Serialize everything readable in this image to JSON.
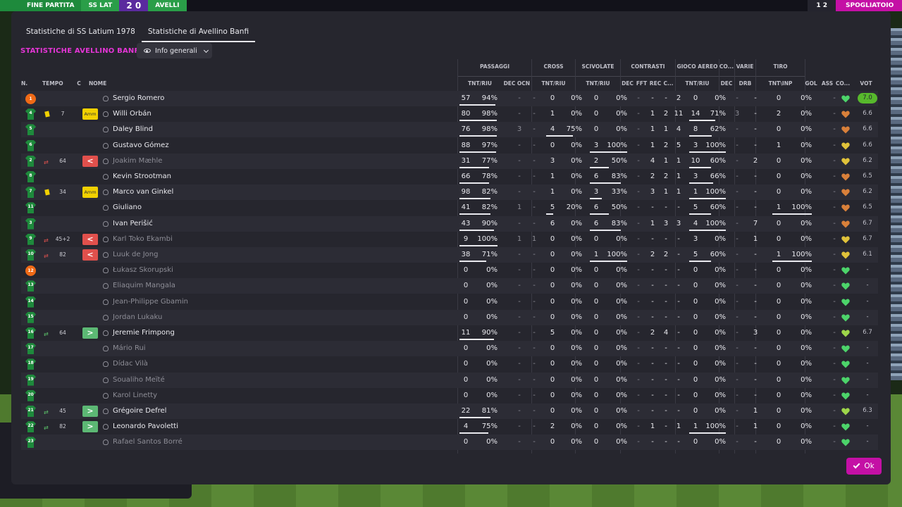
{
  "background": {
    "left_label": "FINE PARTITA",
    "home_abbr": "SS LAT",
    "score": "2 0",
    "away_abbr": "AVELLI",
    "right_score": "1 2",
    "right_button": "SPOGLIATOIO"
  },
  "tabs": [
    {
      "label": "Statistiche di SS Latium 1978",
      "active": false
    },
    {
      "label": "Statistiche di Avellino Banfi",
      "active": true
    }
  ],
  "team_title": "STATISTICHE AVELLINO BANFI",
  "view_dropdown": {
    "selected": "Info generali"
  },
  "groups": {
    "passaggi": "PASSAGGI",
    "cross": "CROSS",
    "scivolate": "SCIVOLATE",
    "contrasti": "CONTRASTI",
    "gioco_aereo": "GIOCO AEREO",
    "co": "CO...",
    "varie": "VARIE",
    "tiro": "TIRO"
  },
  "headers": {
    "n": "N.",
    "tempo": "TEMPO",
    "c": "C",
    "nome": "NOME",
    "pass_tnt": "TNT/RIU",
    "pass_dec": "DEC",
    "pass_ocn": "OCN",
    "cross_tnt": "TNT/RIU",
    "sciv_tnt": "TNT/RIU",
    "con_dec": "DEC",
    "con_fft": "FFT",
    "con_rec": "REC",
    "con_c": "C...",
    "aer_tnt": "TNT/RIU",
    "co_dec": "DEC",
    "var_drb": "DRB",
    "tiro_tnt": "TNT\\INP",
    "gol": "GOL",
    "ass": "ASS",
    "con_col": "CO...",
    "vot": "VOT"
  },
  "heart_colors": {
    "green": "#4cd46a",
    "lime": "#9ed64a",
    "yellow": "#e0c23a",
    "orange": "#d9803a"
  },
  "players": [
    {
      "num": "1",
      "gk": true,
      "tempo": "",
      "ycard": false,
      "sub": "",
      "tag": "",
      "name": "Sergio Romero",
      "active": true,
      "pass_t": "57",
      "pass_p": "94%",
      "pass_fill": 0.94,
      "dec": "-",
      "ocn": "-",
      "cross_t": "0",
      "cross_p": "0%",
      "cross_fill": 0,
      "sciv_t": "0",
      "sciv_p": "0%",
      "sciv_fill": 0,
      "c_dec": "-",
      "c_fft": "-",
      "c_rec": "-",
      "c_c": "2",
      "aer_t": "0",
      "aer_p": "0%",
      "aer_fill": 0,
      "co_dec": "-",
      "drb": "-",
      "tiro_t": "0",
      "tiro_p": "0%",
      "tiro_fill": 0,
      "gol": "",
      "ass": "-",
      "heart": "green",
      "vote": "7.0",
      "vote_hi": true
    },
    {
      "num": "4",
      "gk": false,
      "tempo": "7",
      "ycard": true,
      "sub": "",
      "tag": "amm",
      "tag_label": "Amm",
      "name": "Willi Orbán",
      "active": true,
      "pass_t": "80",
      "pass_p": "98%",
      "pass_fill": 0.98,
      "dec": "-",
      "ocn": "-",
      "cross_t": "1",
      "cross_p": "0%",
      "cross_fill": 0,
      "sciv_t": "0",
      "sciv_p": "0%",
      "sciv_fill": 0,
      "c_dec": "-",
      "c_fft": "1",
      "c_rec": "2",
      "c_c": "11",
      "aer_t": "14",
      "aer_p": "71%",
      "aer_fill": 0.71,
      "co_dec": "3",
      "drb": "-",
      "tiro_t": "2",
      "tiro_p": "0%",
      "tiro_fill": 0,
      "gol": "",
      "ass": "-",
      "heart": "orange",
      "vote": "6.6",
      "vote_hi": false
    },
    {
      "num": "5",
      "gk": false,
      "tempo": "",
      "ycard": false,
      "sub": "",
      "tag": "",
      "name": "Daley Blind",
      "active": true,
      "pass_t": "76",
      "pass_p": "98%",
      "pass_fill": 0.98,
      "dec": "3",
      "ocn": "-",
      "cross_t": "4",
      "cross_p": "75%",
      "cross_fill": 0.75,
      "sciv_t": "0",
      "sciv_p": "0%",
      "sciv_fill": 0,
      "c_dec": "-",
      "c_fft": "1",
      "c_rec": "1",
      "c_c": "4",
      "aer_t": "8",
      "aer_p": "62%",
      "aer_fill": 0.62,
      "co_dec": "-",
      "drb": "-",
      "tiro_t": "0",
      "tiro_p": "0%",
      "tiro_fill": 0,
      "gol": "",
      "ass": "-",
      "heart": "orange",
      "vote": "6.6",
      "vote_hi": false
    },
    {
      "num": "6",
      "gk": false,
      "tempo": "",
      "ycard": false,
      "sub": "",
      "tag": "",
      "name": "Gustavo Gómez",
      "active": true,
      "pass_t": "88",
      "pass_p": "97%",
      "pass_fill": 0.97,
      "dec": "-",
      "ocn": "-",
      "cross_t": "0",
      "cross_p": "0%",
      "cross_fill": 0,
      "sciv_t": "3",
      "sciv_p": "100%",
      "sciv_fill": 1,
      "c_dec": "-",
      "c_fft": "1",
      "c_rec": "2",
      "c_c": "5",
      "aer_t": "3",
      "aer_p": "100%",
      "aer_fill": 1,
      "co_dec": "-",
      "drb": "-",
      "tiro_t": "1",
      "tiro_p": "0%",
      "tiro_fill": 0,
      "gol": "",
      "ass": "-",
      "heart": "yellow",
      "vote": "6.6",
      "vote_hi": false
    },
    {
      "num": "2",
      "gk": false,
      "tempo": "64",
      "ycard": false,
      "sub": "out",
      "tag": "out",
      "tag_label": "<",
      "name": "Joakim Mæhle",
      "active": false,
      "pass_t": "31",
      "pass_p": "77%",
      "pass_fill": 0.77,
      "dec": "-",
      "ocn": "-",
      "cross_t": "3",
      "cross_p": "0%",
      "cross_fill": 0,
      "sciv_t": "2",
      "sciv_p": "50%",
      "sciv_fill": 0.5,
      "c_dec": "-",
      "c_fft": "4",
      "c_rec": "1",
      "c_c": "1",
      "aer_t": "10",
      "aer_p": "60%",
      "aer_fill": 0.6,
      "co_dec": "-",
      "drb": "2",
      "tiro_t": "0",
      "tiro_p": "0%",
      "tiro_fill": 0,
      "gol": "",
      "ass": "-",
      "heart": "yellow",
      "vote": "6.2",
      "vote_hi": false
    },
    {
      "num": "8",
      "gk": false,
      "tempo": "",
      "ycard": false,
      "sub": "",
      "tag": "",
      "name": "Kevin Strootman",
      "active": true,
      "pass_t": "66",
      "pass_p": "78%",
      "pass_fill": 0.78,
      "dec": "-",
      "ocn": "-",
      "cross_t": "1",
      "cross_p": "0%",
      "cross_fill": 0,
      "sciv_t": "6",
      "sciv_p": "83%",
      "sciv_fill": 0.83,
      "c_dec": "-",
      "c_fft": "2",
      "c_rec": "2",
      "c_c": "1",
      "aer_t": "3",
      "aer_p": "66%",
      "aer_fill": 0.66,
      "co_dec": "-",
      "drb": "-",
      "tiro_t": "0",
      "tiro_p": "0%",
      "tiro_fill": 0,
      "gol": "",
      "ass": "-",
      "heart": "orange",
      "vote": "6.5",
      "vote_hi": false
    },
    {
      "num": "7",
      "gk": false,
      "tempo": "34",
      "ycard": true,
      "sub": "",
      "tag": "amm",
      "tag_label": "Amm",
      "name": "Marco van Ginkel",
      "active": true,
      "pass_t": "98",
      "pass_p": "82%",
      "pass_fill": 0.82,
      "dec": "-",
      "ocn": "-",
      "cross_t": "1",
      "cross_p": "0%",
      "cross_fill": 0,
      "sciv_t": "3",
      "sciv_p": "33%",
      "sciv_fill": 0.33,
      "c_dec": "-",
      "c_fft": "3",
      "c_rec": "1",
      "c_c": "1",
      "aer_t": "1",
      "aer_p": "100%",
      "aer_fill": 1,
      "co_dec": "-",
      "drb": "-",
      "tiro_t": "0",
      "tiro_p": "0%",
      "tiro_fill": 0,
      "gol": "",
      "ass": "-",
      "heart": "orange",
      "vote": "6.2",
      "vote_hi": false
    },
    {
      "num": "11",
      "gk": false,
      "tempo": "",
      "ycard": false,
      "sub": "",
      "tag": "",
      "name": "Giuliano",
      "active": true,
      "pass_t": "41",
      "pass_p": "82%",
      "pass_fill": 0.82,
      "dec": "1",
      "ocn": "-",
      "cross_t": "5",
      "cross_p": "20%",
      "cross_fill": 0.2,
      "sciv_t": "6",
      "sciv_p": "50%",
      "sciv_fill": 0.5,
      "c_dec": "-",
      "c_fft": "-",
      "c_rec": "-",
      "c_c": "-",
      "aer_t": "5",
      "aer_p": "60%",
      "aer_fill": 0.6,
      "co_dec": "-",
      "drb": "-",
      "tiro_t": "1",
      "tiro_p": "100%",
      "tiro_fill": 1,
      "gol": "",
      "ass": "-",
      "heart": "orange",
      "vote": "6.5",
      "vote_hi": false
    },
    {
      "num": "3",
      "gk": false,
      "tempo": "",
      "ycard": false,
      "sub": "",
      "tag": "",
      "name": "Ivan Perišić",
      "active": true,
      "pass_t": "43",
      "pass_p": "90%",
      "pass_fill": 0.9,
      "dec": "-",
      "ocn": "-",
      "cross_t": "6",
      "cross_p": "0%",
      "cross_fill": 0,
      "sciv_t": "6",
      "sciv_p": "83%",
      "sciv_fill": 0.83,
      "c_dec": "-",
      "c_fft": "1",
      "c_rec": "3",
      "c_c": "3",
      "aer_t": "4",
      "aer_p": "100%",
      "aer_fill": 1,
      "co_dec": "-",
      "drb": "7",
      "tiro_t": "0",
      "tiro_p": "0%",
      "tiro_fill": 0,
      "gol": "",
      "ass": "-",
      "heart": "orange",
      "vote": "6.7",
      "vote_hi": false
    },
    {
      "num": "9",
      "gk": false,
      "tempo": "45+2",
      "ycard": false,
      "sub": "out",
      "tag": "out",
      "tag_label": "<",
      "name": "Karl Toko Ekambi",
      "active": false,
      "pass_t": "9",
      "pass_p": "100%",
      "pass_fill": 1,
      "dec": "1",
      "ocn": "1",
      "cross_t": "0",
      "cross_p": "0%",
      "cross_fill": 0,
      "sciv_t": "0",
      "sciv_p": "0%",
      "sciv_fill": 0,
      "c_dec": "-",
      "c_fft": "-",
      "c_rec": "-",
      "c_c": "-",
      "aer_t": "3",
      "aer_p": "0%",
      "aer_fill": 0,
      "co_dec": "-",
      "drb": "1",
      "tiro_t": "0",
      "tiro_p": "0%",
      "tiro_fill": 0,
      "gol": "",
      "ass": "-",
      "heart": "yellow",
      "vote": "6.7",
      "vote_hi": false
    },
    {
      "num": "10",
      "gk": false,
      "tempo": "82",
      "ycard": false,
      "sub": "out",
      "tag": "out",
      "tag_label": "<",
      "name": "Luuk de Jong",
      "active": false,
      "pass_t": "38",
      "pass_p": "71%",
      "pass_fill": 0.71,
      "dec": "-",
      "ocn": "-",
      "cross_t": "0",
      "cross_p": "0%",
      "cross_fill": 0,
      "sciv_t": "1",
      "sciv_p": "100%",
      "sciv_fill": 1,
      "c_dec": "-",
      "c_fft": "2",
      "c_rec": "2",
      "c_c": "-",
      "aer_t": "5",
      "aer_p": "60%",
      "aer_fill": 0.6,
      "co_dec": "-",
      "drb": "-",
      "tiro_t": "1",
      "tiro_p": "100%",
      "tiro_fill": 1,
      "gol": "",
      "ass": "-",
      "heart": "yellow",
      "vote": "6.1",
      "vote_hi": false
    },
    {
      "num": "12",
      "gk": true,
      "tempo": "",
      "ycard": false,
      "sub": "",
      "tag": "",
      "name": "Łukasz Skorupski",
      "active": false,
      "pass_t": "0",
      "pass_p": "0%",
      "pass_fill": 0,
      "dec": "-",
      "ocn": "-",
      "cross_t": "0",
      "cross_p": "0%",
      "cross_fill": 0,
      "sciv_t": "0",
      "sciv_p": "0%",
      "sciv_fill": 0,
      "c_dec": "-",
      "c_fft": "-",
      "c_rec": "-",
      "c_c": "-",
      "aer_t": "0",
      "aer_p": "0%",
      "aer_fill": 0,
      "co_dec": "-",
      "drb": "-",
      "tiro_t": "0",
      "tiro_p": "0%",
      "tiro_fill": 0,
      "gol": "",
      "ass": "-",
      "heart": "green",
      "vote": "-",
      "vote_hi": false
    },
    {
      "num": "13",
      "gk": false,
      "tempo": "",
      "ycard": false,
      "sub": "",
      "tag": "",
      "name": "Eliaquim Mangala",
      "active": false,
      "pass_t": "0",
      "pass_p": "0%",
      "pass_fill": 0,
      "dec": "-",
      "ocn": "-",
      "cross_t": "0",
      "cross_p": "0%",
      "cross_fill": 0,
      "sciv_t": "0",
      "sciv_p": "0%",
      "sciv_fill": 0,
      "c_dec": "-",
      "c_fft": "-",
      "c_rec": "-",
      "c_c": "-",
      "aer_t": "0",
      "aer_p": "0%",
      "aer_fill": 0,
      "co_dec": "-",
      "drb": "-",
      "tiro_t": "0",
      "tiro_p": "0%",
      "tiro_fill": 0,
      "gol": "",
      "ass": "-",
      "heart": "green",
      "vote": "-",
      "vote_hi": false
    },
    {
      "num": "14",
      "gk": false,
      "tempo": "",
      "ycard": false,
      "sub": "",
      "tag": "",
      "name": "Jean-Philippe Gbamin",
      "active": false,
      "pass_t": "0",
      "pass_p": "0%",
      "pass_fill": 0,
      "dec": "-",
      "ocn": "-",
      "cross_t": "0",
      "cross_p": "0%",
      "cross_fill": 0,
      "sciv_t": "0",
      "sciv_p": "0%",
      "sciv_fill": 0,
      "c_dec": "-",
      "c_fft": "-",
      "c_rec": "-",
      "c_c": "-",
      "aer_t": "0",
      "aer_p": "0%",
      "aer_fill": 0,
      "co_dec": "-",
      "drb": "-",
      "tiro_t": "0",
      "tiro_p": "0%",
      "tiro_fill": 0,
      "gol": "",
      "ass": "-",
      "heart": "green",
      "vote": "-",
      "vote_hi": false
    },
    {
      "num": "15",
      "gk": false,
      "tempo": "",
      "ycard": false,
      "sub": "",
      "tag": "",
      "name": "Jordan Lukaku",
      "active": false,
      "pass_t": "0",
      "pass_p": "0%",
      "pass_fill": 0,
      "dec": "-",
      "ocn": "-",
      "cross_t": "0",
      "cross_p": "0%",
      "cross_fill": 0,
      "sciv_t": "0",
      "sciv_p": "0%",
      "sciv_fill": 0,
      "c_dec": "-",
      "c_fft": "-",
      "c_rec": "-",
      "c_c": "-",
      "aer_t": "0",
      "aer_p": "0%",
      "aer_fill": 0,
      "co_dec": "-",
      "drb": "-",
      "tiro_t": "0",
      "tiro_p": "0%",
      "tiro_fill": 0,
      "gol": "",
      "ass": "-",
      "heart": "green",
      "vote": "-",
      "vote_hi": false
    },
    {
      "num": "16",
      "gk": false,
      "tempo": "64",
      "ycard": false,
      "sub": "in",
      "tag": "in",
      "tag_label": ">",
      "name": "Jeremie Frimpong",
      "active": true,
      "pass_t": "11",
      "pass_p": "90%",
      "pass_fill": 0.9,
      "dec": "-",
      "ocn": "-",
      "cross_t": "5",
      "cross_p": "0%",
      "cross_fill": 0,
      "sciv_t": "0",
      "sciv_p": "0%",
      "sciv_fill": 0,
      "c_dec": "-",
      "c_fft": "2",
      "c_rec": "4",
      "c_c": "-",
      "aer_t": "0",
      "aer_p": "0%",
      "aer_fill": 0,
      "co_dec": "-",
      "drb": "3",
      "tiro_t": "0",
      "tiro_p": "0%",
      "tiro_fill": 0,
      "gol": "",
      "ass": "-",
      "heart": "lime",
      "vote": "6.7",
      "vote_hi": false
    },
    {
      "num": "17",
      "gk": false,
      "tempo": "",
      "ycard": false,
      "sub": "",
      "tag": "",
      "name": "Mário Rui",
      "active": false,
      "pass_t": "0",
      "pass_p": "0%",
      "pass_fill": 0,
      "dec": "-",
      "ocn": "-",
      "cross_t": "0",
      "cross_p": "0%",
      "cross_fill": 0,
      "sciv_t": "0",
      "sciv_p": "0%",
      "sciv_fill": 0,
      "c_dec": "-",
      "c_fft": "-",
      "c_rec": "-",
      "c_c": "-",
      "aer_t": "0",
      "aer_p": "0%",
      "aer_fill": 0,
      "co_dec": "-",
      "drb": "-",
      "tiro_t": "0",
      "tiro_p": "0%",
      "tiro_fill": 0,
      "gol": "",
      "ass": "-",
      "heart": "green",
      "vote": "-",
      "vote_hi": false
    },
    {
      "num": "18",
      "gk": false,
      "tempo": "",
      "ycard": false,
      "sub": "",
      "tag": "",
      "name": "Dídac Vilà",
      "active": false,
      "pass_t": "0",
      "pass_p": "0%",
      "pass_fill": 0,
      "dec": "-",
      "ocn": "-",
      "cross_t": "0",
      "cross_p": "0%",
      "cross_fill": 0,
      "sciv_t": "0",
      "sciv_p": "0%",
      "sciv_fill": 0,
      "c_dec": "-",
      "c_fft": "-",
      "c_rec": "-",
      "c_c": "-",
      "aer_t": "0",
      "aer_p": "0%",
      "aer_fill": 0,
      "co_dec": "-",
      "drb": "-",
      "tiro_t": "0",
      "tiro_p": "0%",
      "tiro_fill": 0,
      "gol": "",
      "ass": "-",
      "heart": "green",
      "vote": "-",
      "vote_hi": false
    },
    {
      "num": "19",
      "gk": false,
      "tempo": "",
      "ycard": false,
      "sub": "",
      "tag": "",
      "name": "Soualiho Meïté",
      "active": false,
      "pass_t": "0",
      "pass_p": "0%",
      "pass_fill": 0,
      "dec": "-",
      "ocn": "-",
      "cross_t": "0",
      "cross_p": "0%",
      "cross_fill": 0,
      "sciv_t": "0",
      "sciv_p": "0%",
      "sciv_fill": 0,
      "c_dec": "-",
      "c_fft": "-",
      "c_rec": "-",
      "c_c": "-",
      "aer_t": "0",
      "aer_p": "0%",
      "aer_fill": 0,
      "co_dec": "-",
      "drb": "-",
      "tiro_t": "0",
      "tiro_p": "0%",
      "tiro_fill": 0,
      "gol": "",
      "ass": "-",
      "heart": "green",
      "vote": "-",
      "vote_hi": false
    },
    {
      "num": "20",
      "gk": false,
      "tempo": "",
      "ycard": false,
      "sub": "",
      "tag": "",
      "name": "Karol Linetty",
      "active": false,
      "pass_t": "0",
      "pass_p": "0%",
      "pass_fill": 0,
      "dec": "-",
      "ocn": "-",
      "cross_t": "0",
      "cross_p": "0%",
      "cross_fill": 0,
      "sciv_t": "0",
      "sciv_p": "0%",
      "sciv_fill": 0,
      "c_dec": "-",
      "c_fft": "-",
      "c_rec": "-",
      "c_c": "-",
      "aer_t": "0",
      "aer_p": "0%",
      "aer_fill": 0,
      "co_dec": "-",
      "drb": "-",
      "tiro_t": "0",
      "tiro_p": "0%",
      "tiro_fill": 0,
      "gol": "",
      "ass": "-",
      "heart": "green",
      "vote": "-",
      "vote_hi": false
    },
    {
      "num": "21",
      "gk": false,
      "tempo": "45",
      "ycard": false,
      "sub": "in",
      "tag": "in",
      "tag_label": ">",
      "name": "Grégoire Defrel",
      "active": true,
      "pass_t": "22",
      "pass_p": "81%",
      "pass_fill": 0.81,
      "dec": "-",
      "ocn": "-",
      "cross_t": "0",
      "cross_p": "0%",
      "cross_fill": 0,
      "sciv_t": "0",
      "sciv_p": "0%",
      "sciv_fill": 0,
      "c_dec": "-",
      "c_fft": "-",
      "c_rec": "-",
      "c_c": "-",
      "aer_t": "0",
      "aer_p": "0%",
      "aer_fill": 0,
      "co_dec": "-",
      "drb": "1",
      "tiro_t": "0",
      "tiro_p": "0%",
      "tiro_fill": 0,
      "gol": "",
      "ass": "-",
      "heart": "lime",
      "vote": "6.3",
      "vote_hi": false
    },
    {
      "num": "22",
      "gk": false,
      "tempo": "82",
      "ycard": false,
      "sub": "in",
      "tag": "in",
      "tag_label": ">",
      "name": "Leonardo Pavoletti",
      "active": true,
      "pass_t": "4",
      "pass_p": "75%",
      "pass_fill": 0.75,
      "dec": "-",
      "ocn": "-",
      "cross_t": "2",
      "cross_p": "0%",
      "cross_fill": 0,
      "sciv_t": "0",
      "sciv_p": "0%",
      "sciv_fill": 0,
      "c_dec": "-",
      "c_fft": "1",
      "c_rec": "-",
      "c_c": "1",
      "aer_t": "1",
      "aer_p": "100%",
      "aer_fill": 1,
      "co_dec": "-",
      "drb": "1",
      "tiro_t": "0",
      "tiro_p": "0%",
      "tiro_fill": 0,
      "gol": "",
      "ass": "-",
      "heart": "green",
      "vote": "-",
      "vote_hi": false
    },
    {
      "num": "23",
      "gk": false,
      "tempo": "",
      "ycard": false,
      "sub": "",
      "tag": "",
      "name": "Rafael Santos Borré",
      "active": false,
      "pass_t": "0",
      "pass_p": "0%",
      "pass_fill": 0,
      "dec": "-",
      "ocn": "-",
      "cross_t": "0",
      "cross_p": "0%",
      "cross_fill": 0,
      "sciv_t": "0",
      "sciv_p": "0%",
      "sciv_fill": 0,
      "c_dec": "-",
      "c_fft": "-",
      "c_rec": "-",
      "c_c": "-",
      "aer_t": "0",
      "aer_p": "0%",
      "aer_fill": 0,
      "co_dec": "-",
      "drb": "-",
      "tiro_t": "0",
      "tiro_p": "0%",
      "tiro_fill": 0,
      "gol": "",
      "ass": "-",
      "heart": "green",
      "vote": "-",
      "vote_hi": false
    }
  ],
  "ok_button": "Ok"
}
